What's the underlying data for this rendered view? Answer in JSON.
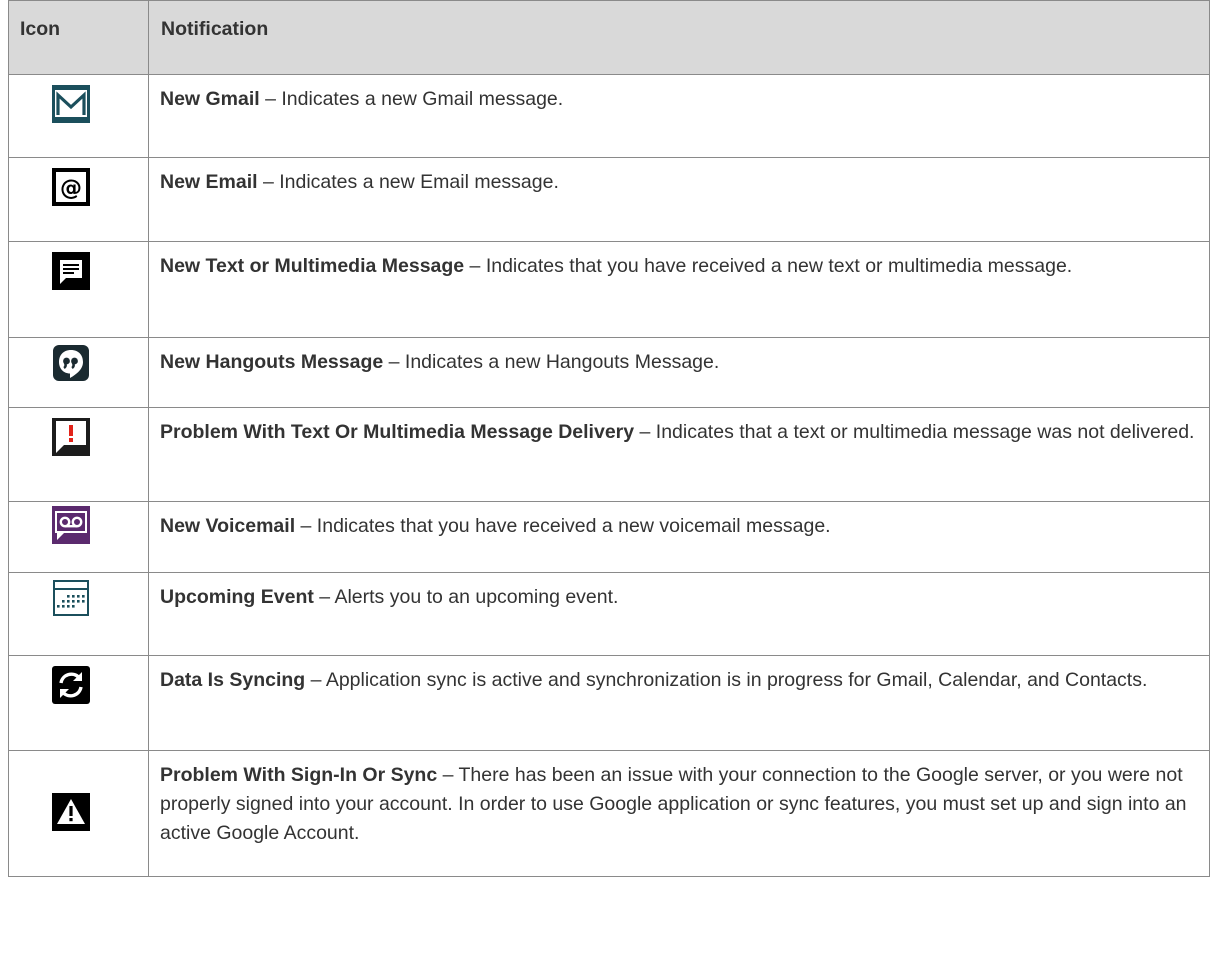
{
  "table": {
    "headers": {
      "icon": "Icon",
      "notification": "Notification"
    },
    "rows": [
      {
        "icon": "gmail-icon",
        "title": "New Gmail",
        "description": " – Indicates a new Gmail message."
      },
      {
        "icon": "email-at-icon",
        "title": "New Email",
        "description": " – Indicates a new Email message."
      },
      {
        "icon": "text-message-icon",
        "title": "New Text or Multimedia Message",
        "description": " – Indicates that you have received a new text or multimedia message."
      },
      {
        "icon": "hangouts-icon",
        "title": "New Hangouts Message",
        "description": " – Indicates a new Hangouts Message."
      },
      {
        "icon": "message-delivery-error-icon",
        "title": "Problem With Text Or Multimedia Message Delivery",
        "description": " – Indicates that a text or multimedia message was not delivered."
      },
      {
        "icon": "voicemail-icon",
        "title": "New Voicemail",
        "description": " – Indicates that you have received a new voicemail message."
      },
      {
        "icon": "calendar-icon",
        "title": "Upcoming Event",
        "description": " – Alerts you to an upcoming event."
      },
      {
        "icon": "sync-icon",
        "title": "Data Is Syncing",
        "description": " – Application sync is active and synchronization is in progress for Gmail, Calendar, and Contacts."
      },
      {
        "icon": "warning-icon",
        "title": "Problem With Sign-In Or Sync",
        "description": " – There has been an issue with your connection to the Google server, or you were not properly signed into your account. In order to use Google application or sync features, you must set up and sign into an active Google Account."
      }
    ]
  },
  "colors": {
    "header_bg": "#d9d9d9",
    "border": "#8a8a8a",
    "text": "#333333",
    "icon_teal": "#1b4f5c",
    "icon_purple": "#5b2a6e",
    "icon_red": "#e2231a"
  }
}
